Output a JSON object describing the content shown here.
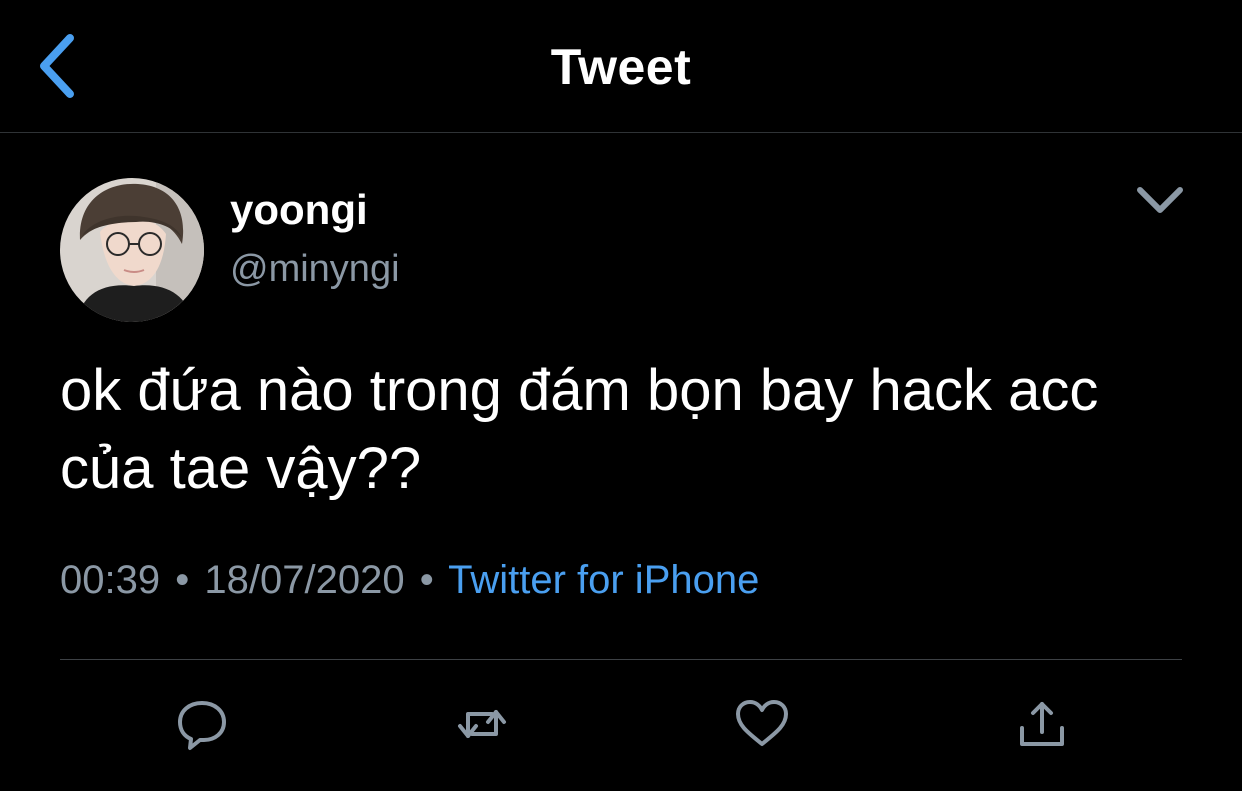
{
  "header": {
    "title": "Tweet"
  },
  "tweet": {
    "display_name": "yoongi",
    "handle": "@minyngi",
    "text_line1": "ok đứa nào trong đám bọn bay hack acc",
    "text_line2": "của tae vậy??",
    "time": "00:39",
    "date": "18/07/2020",
    "separator": "•",
    "source": "Twitter for iPhone"
  },
  "icons": {
    "back": "chevron-left-icon",
    "more": "chevron-down-icon",
    "reply": "reply-icon",
    "retweet": "retweet-icon",
    "like": "heart-icon",
    "share": "share-icon"
  },
  "colors": {
    "background": "#000000",
    "text": "#ffffff",
    "muted": "#8b98a5",
    "accent": "#4a9ff0",
    "icon": "#8b98a5"
  }
}
